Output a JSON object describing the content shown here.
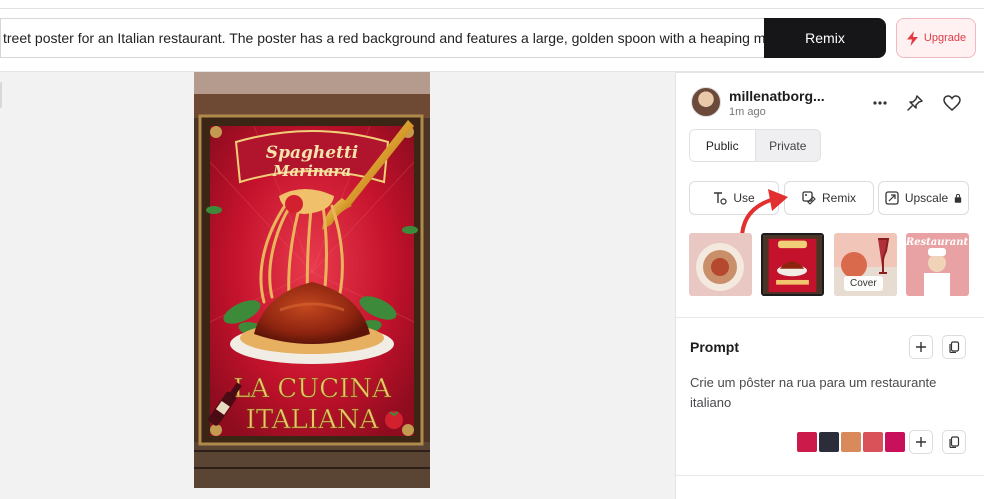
{
  "header": {
    "prompt_text": "treet poster for an Italian restaurant. The poster has a red background and features a large, golden spoon with a heaping mou",
    "remix_label": "Remix",
    "upgrade_label": "Upgrade"
  },
  "poster": {
    "banner_line1": "Spaghetti",
    "banner_line2": "Marinara",
    "headline_line1": "LA CUCINA",
    "headline_line2": "ITALIANA"
  },
  "panel": {
    "username": "millenatborg...",
    "time": "1m ago",
    "visibility": [
      "Public",
      "Private"
    ],
    "actions": {
      "use": "Use",
      "remix": "Remix",
      "upscale": "Upscale"
    },
    "thumbnails": [
      {
        "kind": "pasta-plate"
      },
      {
        "kind": "current-poster"
      },
      {
        "kind": "wine-table",
        "tag": "Cover"
      },
      {
        "kind": "chef-restaurant",
        "headline": "Restaurant"
      }
    ],
    "prompt_title": "Prompt",
    "prompt_text": "Crie um pôster na rua para um restaurante italiano",
    "palette": [
      "#cc1a4b",
      "#2b2d3b",
      "#d98a5a",
      "#d9525a",
      "#c8115a"
    ]
  }
}
